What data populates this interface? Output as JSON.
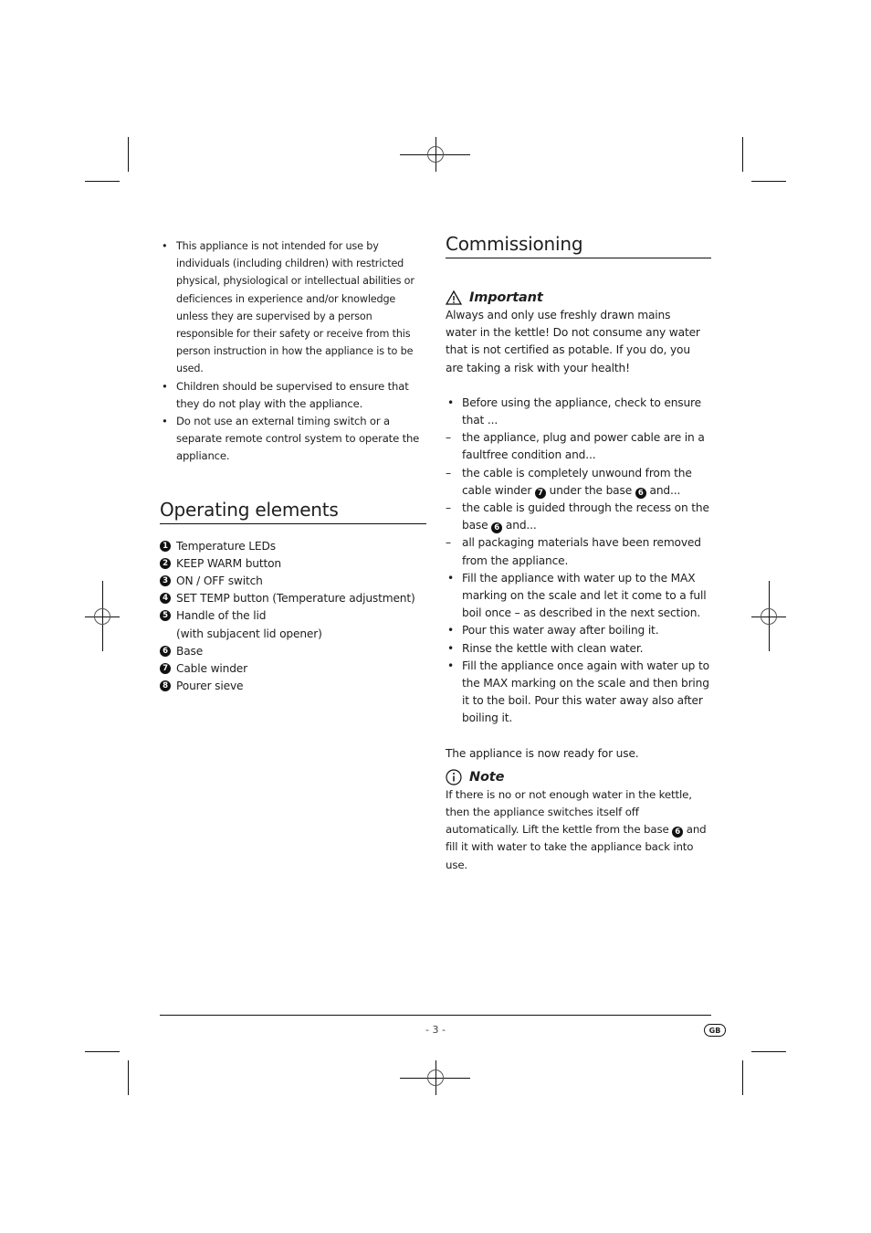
{
  "left": {
    "intro_bullets": [
      "This appliance is not intended for use by individuals (including children) with restricted physical, physio­logical or intellectual abilities or deficiences in experience and/or knowledge unless they are supervised by a person responsible for their safety or receive from this person instruction in how the appliance is to be used.",
      "Children should be supervised to ensure that they do not play with the appliance.",
      "Do not use an external timing switch or a separate remote control system to operate the appliance."
    ],
    "operating_elements": {
      "heading": "Operating elements",
      "items": [
        {
          "num": "1",
          "label": "Temperature LEDs"
        },
        {
          "num": "2",
          "label": "KEEP WARM button"
        },
        {
          "num": "3",
          "label": "ON / OFF switch"
        },
        {
          "num": "4",
          "label": "SET TEMP button (Temperature adjustment)"
        },
        {
          "num": "5",
          "label": "Handle of the lid",
          "sub": "(with subjacent lid opener)"
        },
        {
          "num": "6",
          "label": "Base"
        },
        {
          "num": "7",
          "label": "Cable winder"
        },
        {
          "num": "8",
          "label": "Pourer sieve"
        }
      ]
    }
  },
  "right": {
    "heading": "Commissioning",
    "important": {
      "icon": "warning-triangle-icon",
      "title": "Important",
      "text": "Always and only use freshly drawn mains water in the kettle! Do not consume any water that is not certified as potable. If you do, you are taking a risk with your health!"
    },
    "steps": {
      "s1": "Before using the appliance, check to ensure that ...",
      "d1": "the appliance, plug and power cable are in a faultfree condition and...",
      "d2a": "the cable is completely unwound from the cable winder",
      "d2_ref1": "7",
      "d2b": "under the base",
      "d2_ref2": "6",
      "d2c": "and...",
      "d3a": "the cable is guided through the recess on the base",
      "d3_ref": "6",
      "d3b": "and...",
      "d4": "all packaging materials have been removed from the appliance.",
      "s2": "Fill the appliance with water up to the MAX marking on the scale and let it come to a full boil once – as described in the next section.",
      "s3": "Pour this water away after boiling it.",
      "s4": "Rinse the kettle with clean water.",
      "s5": "Fill the appliance once again with water up to the MAX marking on the scale and then bring it to the boil. Pour this water away also after boiling it."
    },
    "ready": "The appliance is now ready for use.",
    "note": {
      "icon": "info-circle-icon",
      "title": "Note",
      "text_a": "If there is no or not enough water in the kettle, then the appliance switches itself off automatically. Lift the kettle from the base",
      "ref": "6",
      "text_b": "and fill it with water to take the appliance back into use."
    }
  },
  "footer": {
    "page_number": "- 3 -",
    "language_badge": "GB"
  }
}
